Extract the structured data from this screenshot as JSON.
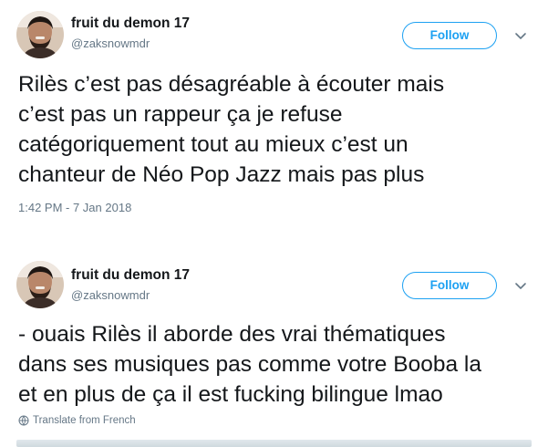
{
  "tweets": [
    {
      "display_name": "fruit du demon 17",
      "handle": "@zaksnowmdr",
      "follow_label": "Follow",
      "text": "Rilès c’est pas désagréable à écouter mais\nc’est pas un rappeur ça je refuse\ncatégoriquement tout au mieux c’est un\nchanteur de Néo Pop Jazz mais pas plus",
      "timestamp": "1:42 PM - 7 Jan 2018"
    },
    {
      "display_name": "fruit du demon 17",
      "handle": "@zaksnowmdr",
      "follow_label": "Follow",
      "text": "- ouais Rilès il aborde des vrai thématiques\ndans ses musiques pas comme votre Booba la\net en plus de ça il est fucking bilingue lmao",
      "translate_label": "Translate from French"
    }
  ],
  "colors": {
    "accent": "#1da1f2",
    "secondary_text": "#657786",
    "primary_text": "#14171a"
  },
  "icons": {
    "avatar": "profile-photo",
    "menu": "chevron-down-icon",
    "translate": "globe-icon"
  }
}
